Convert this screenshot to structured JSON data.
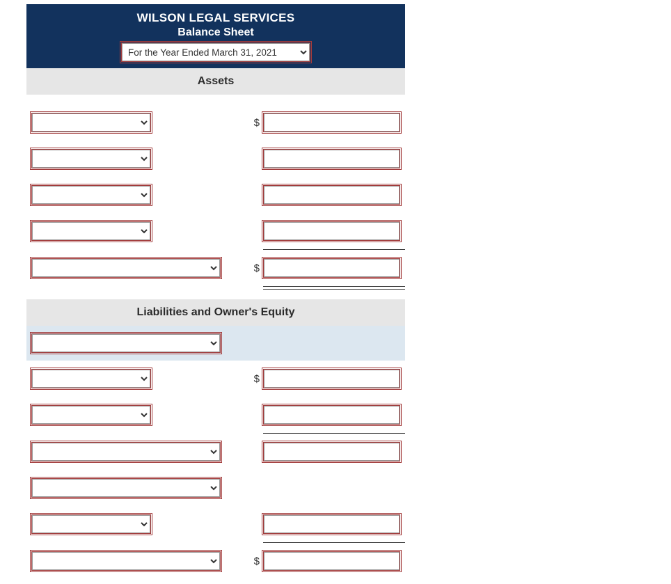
{
  "header": {
    "company": "WILSON LEGAL SERVICES",
    "title": "Balance Sheet",
    "period": "For the Year Ended March 31, 2021"
  },
  "sections": {
    "assets": "Assets",
    "liab_equity": "Liabilities and Owner's Equity"
  },
  "currency": "$",
  "assets": {
    "lines": [
      {
        "account": "",
        "amount": "",
        "show_currency": true
      },
      {
        "account": "",
        "amount": ""
      },
      {
        "account": "",
        "amount": ""
      },
      {
        "account": "",
        "amount": ""
      }
    ],
    "total": {
      "account": "",
      "amount": "",
      "show_currency": true
    }
  },
  "liab_equity": {
    "group_label": "",
    "liab_lines": [
      {
        "account": "",
        "amount": "",
        "show_currency": true
      },
      {
        "account": "",
        "amount": ""
      }
    ],
    "liab_subtotal": {
      "account": "",
      "amount": ""
    },
    "equity_label": {
      "account": ""
    },
    "equity_line": {
      "account": "",
      "amount": ""
    },
    "total": {
      "account": "",
      "amount": "",
      "show_currency": true
    }
  }
}
